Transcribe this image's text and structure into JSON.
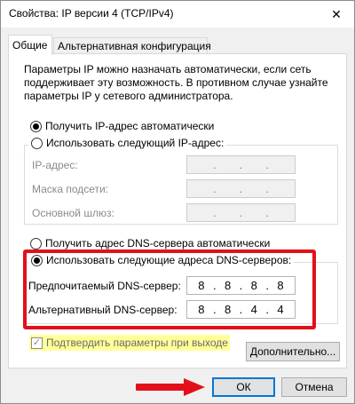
{
  "window": {
    "title": "Свойства: IP версии 4 (TCP/IPv4)",
    "close_glyph": "✕"
  },
  "tabs": [
    {
      "label": "Общие",
      "active": true
    },
    {
      "label": "Альтернативная конфигурация",
      "active": false
    }
  ],
  "description": "Параметры IP можно назначать автоматически, если сеть поддерживает эту возможность. В противном случае узнайте параметры IP у сетевого администратора.",
  "ip": {
    "auto_label": "Получить IP-адрес автоматически",
    "auto_selected": true,
    "manual_label": "Использовать следующий IP-адрес:",
    "manual_selected": false,
    "address_label": "IP-адрес:",
    "mask_label": "Маска подсети:",
    "gateway_label": "Основной шлюз:",
    "address_value": [
      "",
      "",
      "",
      ""
    ],
    "mask_value": [
      "",
      "",
      "",
      ""
    ],
    "gateway_value": [
      "",
      "",
      "",
      ""
    ]
  },
  "dns": {
    "auto_label": "Получить адрес DNS-сервера автоматически",
    "auto_selected": false,
    "manual_label": "Использовать следующие адреса DNS-серверов:",
    "manual_selected": true,
    "preferred_label": "Предпочитаемый DNS-сервер:",
    "alternate_label": "Альтернативный DNS-сервер:",
    "preferred_value": [
      "8",
      "8",
      "8",
      "8"
    ],
    "alternate_value": [
      "8",
      "8",
      "4",
      "4"
    ]
  },
  "validate": {
    "label": "Подтвердить параметры при выходе",
    "checked": true,
    "check_glyph": "✓"
  },
  "buttons": {
    "advanced": "Дополнительно...",
    "ok": "ОК",
    "cancel": "Отмена"
  },
  "colors": {
    "highlight_frame": "#e3101a",
    "checkbox_highlight": "#ffff99",
    "default_button_border": "#0078d7"
  },
  "icons": {
    "close": "close-icon",
    "pointer_arrow": "arrow-right-icon"
  }
}
